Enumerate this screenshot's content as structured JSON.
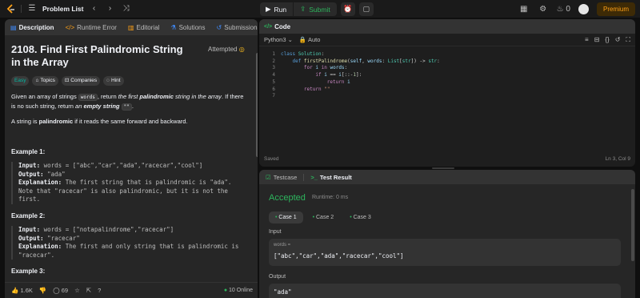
{
  "nav": {
    "title": "Problem List",
    "run_label": "Run",
    "submit_label": "Submit",
    "streak_count": "0",
    "premium_label": "Premium"
  },
  "left_tabs": [
    {
      "label": "Description"
    },
    {
      "label": "Runtime Error"
    },
    {
      "label": "Editorial"
    },
    {
      "label": "Solutions"
    },
    {
      "label": "Submissions"
    }
  ],
  "problem": {
    "title": "2108. Find First Palindromic String in the Array",
    "status": "Attempted",
    "tags": [
      "Easy",
      "Topics",
      "Companies",
      "Hint"
    ],
    "desc1_a": "Given an array of strings ",
    "desc1_code": "words",
    "desc1_b": ", return ",
    "desc1_c": "the first ",
    "desc1_d": "palindromic",
    "desc1_e": " string in the array",
    "desc1_f": ". If there is no such string, return ",
    "desc1_g": "an ",
    "desc1_h": "empty string",
    "desc1_code2": "\"\"",
    "desc1_i": ".",
    "desc2_a": "A string is ",
    "desc2_b": "palindromic",
    "desc2_c": " if it reads the same forward and backward.",
    "examples": [
      {
        "title": "Example 1:",
        "input_label": "Input:",
        "input": "words = [\"abc\",\"car\",\"ada\",\"racecar\",\"cool\"]",
        "output_label": "Output:",
        "output": "\"ada\"",
        "expl_label": "Explanation:",
        "expl": "The first string that is palindromic is \"ada\".",
        "expl2": "Note that \"racecar\" is also palindromic, but it is not the",
        "expl3": "first."
      },
      {
        "title": "Example 2:",
        "input_label": "Input:",
        "input": "words = [\"notapalindrome\",\"racecar\"]",
        "output_label": "Output:",
        "output": "\"racecar\"",
        "expl_label": "Explanation:",
        "expl": "The first and only string that is palindromic is",
        "expl2": "\"racecar\"."
      },
      {
        "title": "Example 3:"
      }
    ]
  },
  "left_footer": {
    "likes": "1.6K",
    "comments": "69",
    "online": "10 Online"
  },
  "code_panel": {
    "title": "Code",
    "language": "Python3",
    "mode": "Auto",
    "status": "Saved",
    "cursor": "Ln 3, Col 9",
    "line_numbers": [
      "1",
      "2",
      "3",
      "4",
      "5",
      "6",
      "7"
    ]
  },
  "result_panel": {
    "tab_testcase": "Testcase",
    "tab_result": "Test Result",
    "verdict": "Accepted",
    "runtime": "Runtime: 0 ms",
    "cases": [
      "Case 1",
      "Case 2",
      "Case 3"
    ],
    "input_label": "Input",
    "input_var": "words =",
    "input_value": "[\"abc\",\"car\",\"ada\",\"racecar\",\"cool\"]",
    "output_label": "Output",
    "output_value": "\"ada\""
  },
  "colors": {
    "accent_green": "#2db55d",
    "premium_orange": "#ffa116",
    "easy_teal": "#00b8a3"
  },
  "icons": [
    "logo-icon",
    "list-icon",
    "chevron-left-icon",
    "chevron-right-icon",
    "shuffle-icon",
    "play-icon",
    "upload-icon",
    "alarm-icon",
    "note-icon",
    "layout-icon",
    "settings-icon",
    "fire-icon"
  ]
}
